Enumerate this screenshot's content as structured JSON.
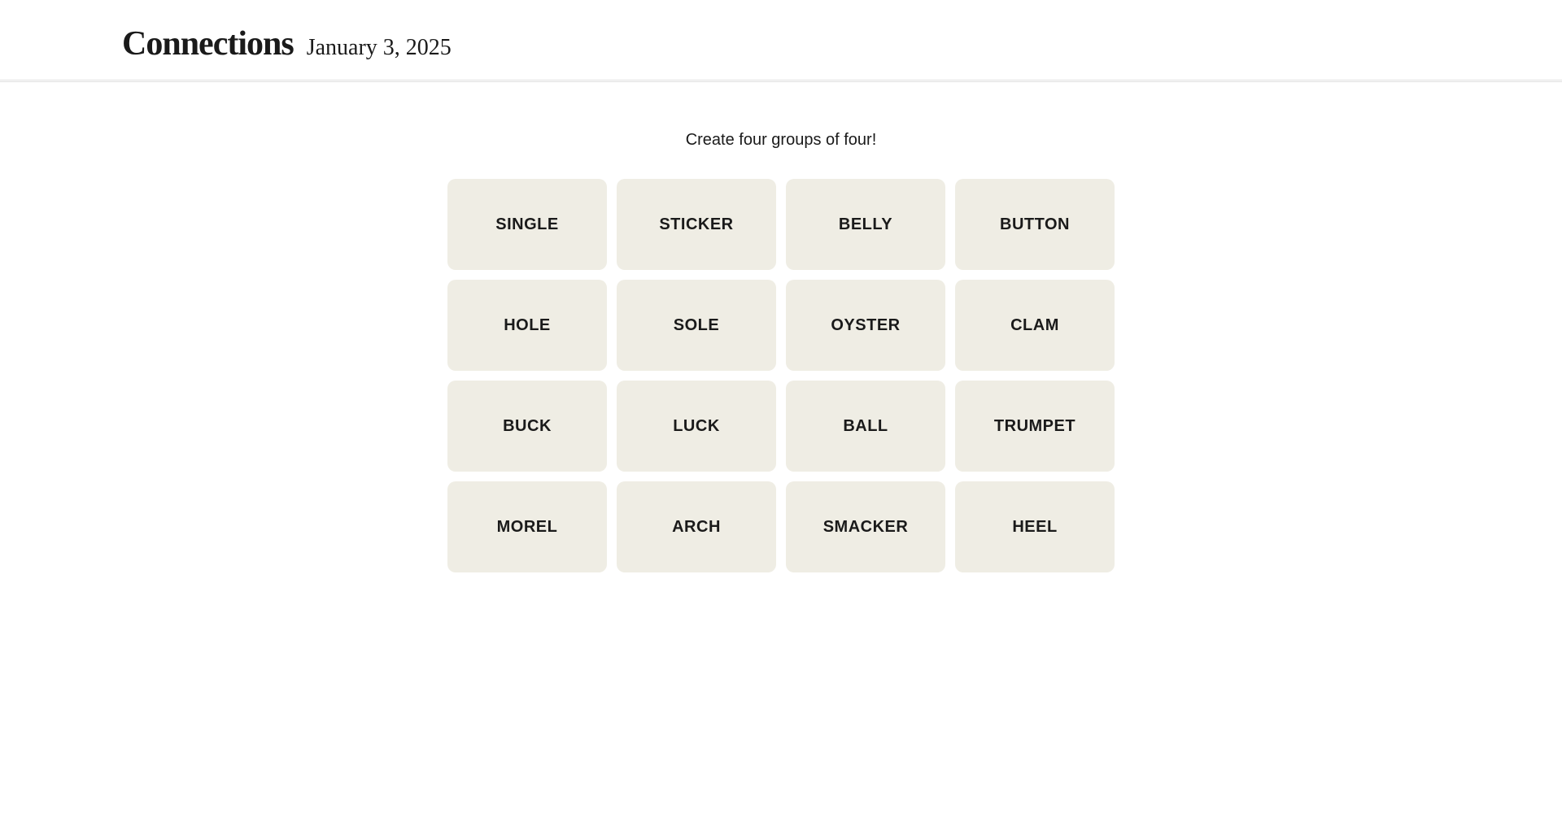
{
  "header": {
    "title": "Connections",
    "date": "January 3, 2025"
  },
  "game": {
    "instructions": "Create four groups of four!",
    "tiles": [
      {
        "id": "tile-single",
        "label": "SINGLE"
      },
      {
        "id": "tile-sticker",
        "label": "STICKER"
      },
      {
        "id": "tile-belly",
        "label": "BELLY"
      },
      {
        "id": "tile-button",
        "label": "BUTTON"
      },
      {
        "id": "tile-hole",
        "label": "HOLE"
      },
      {
        "id": "tile-sole",
        "label": "SOLE"
      },
      {
        "id": "tile-oyster",
        "label": "OYSTER"
      },
      {
        "id": "tile-clam",
        "label": "CLAM"
      },
      {
        "id": "tile-buck",
        "label": "BUCK"
      },
      {
        "id": "tile-luck",
        "label": "LUCK"
      },
      {
        "id": "tile-ball",
        "label": "BALL"
      },
      {
        "id": "tile-trumpet",
        "label": "TRUMPET"
      },
      {
        "id": "tile-morel",
        "label": "MOREL"
      },
      {
        "id": "tile-arch",
        "label": "ARCH"
      },
      {
        "id": "tile-smacker",
        "label": "SMACKER"
      },
      {
        "id": "tile-heel",
        "label": "HEEL"
      }
    ]
  }
}
